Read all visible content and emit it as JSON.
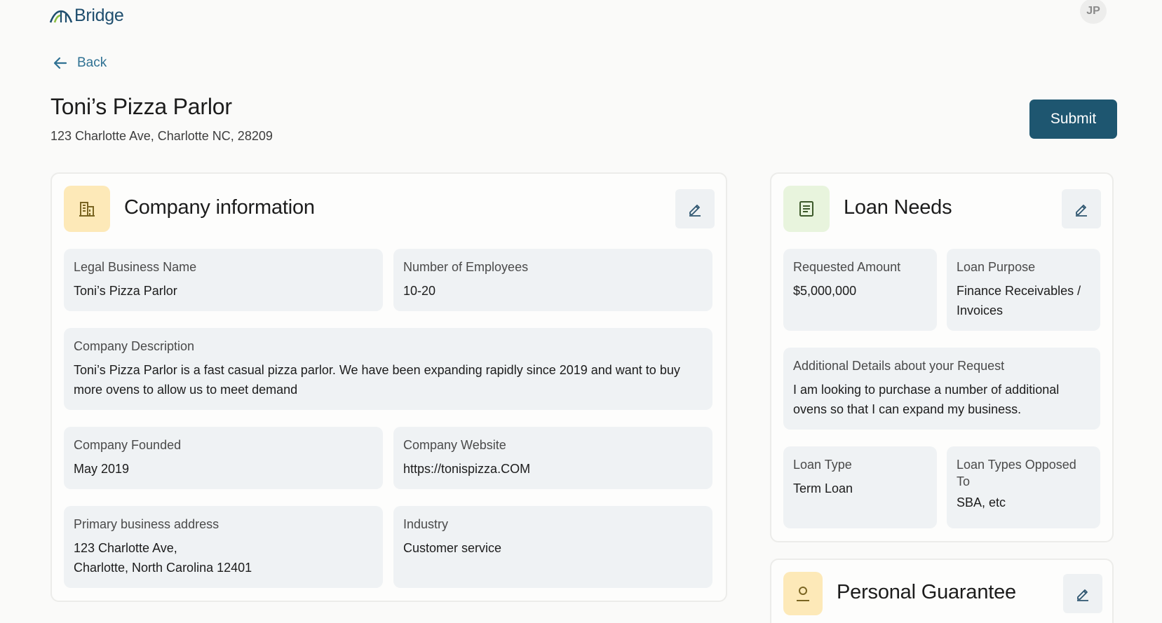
{
  "header": {
    "logo_text": "Bridge",
    "avatar_initials": "JP"
  },
  "nav": {
    "back_label": "Back"
  },
  "business": {
    "name": "Toni’s Pizza Parlor",
    "address": "123 Charlotte Ave, Charlotte NC, 28209"
  },
  "actions": {
    "submit_label": "Submit"
  },
  "company": {
    "title": "Company information",
    "fields": [
      {
        "label": "Legal Business Name",
        "value": "Toni’s Pizza Parlor"
      },
      {
        "label": "Number of Employees",
        "value": "10-20"
      },
      {
        "label": "Company Description",
        "value": "Toni’s Pizza Parlor is a fast casual pizza parlor. We have been expanding rapidly since 2019 and want to buy more ovens to allow us to meet demand"
      },
      {
        "label": "Company Founded",
        "value": "May 2019"
      },
      {
        "label": "Company Website",
        "value": "https://tonispizza.COM"
      },
      {
        "label": "Primary business address",
        "value": "123 Charlotte Ave,\nCharlotte, North Carolina 12401"
      },
      {
        "label": "Industry",
        "value": "Customer service"
      }
    ]
  },
  "loan": {
    "title": "Loan Needs",
    "fields": [
      {
        "label": "Requested Amount",
        "value": "$5,000,000"
      },
      {
        "label": "Loan Purpose",
        "value": "Finance Receivables / Invoices"
      },
      {
        "label": "Additional Details about your Request",
        "value": "I am looking to purchase a number of additional ovens so that I can expand my business."
      },
      {
        "label": "Loan Type",
        "value": "Term Loan"
      },
      {
        "label": "Loan Types Opposed To",
        "value": "SBA, etc"
      }
    ]
  },
  "guarantee": {
    "title": "Personal Guarantee"
  },
  "colors": {
    "primary": "#1e5670",
    "link": "#2f7193",
    "company_icon_bg": "#fde9b8",
    "loan_icon_bg": "#e8f4dd",
    "field_bg": "#eff2f4"
  },
  "icons": {
    "company": "building-icon",
    "loan": "document-icon",
    "guarantee": "person-icon",
    "edit": "pencil-icon",
    "back": "arrow-left-icon"
  }
}
